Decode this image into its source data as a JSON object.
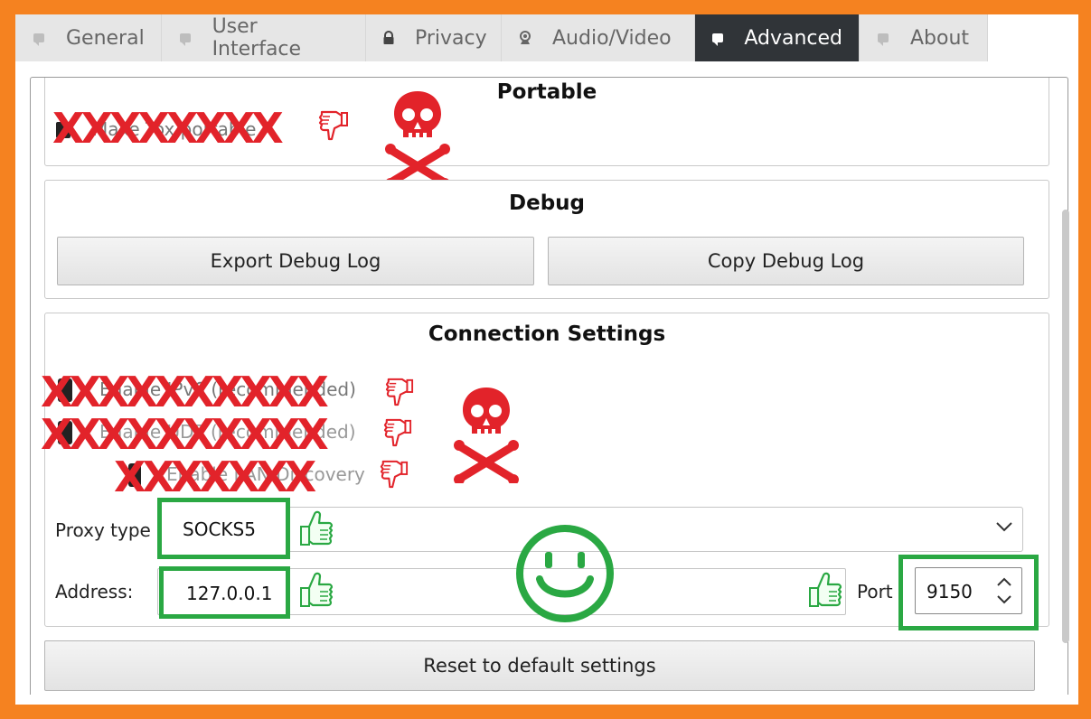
{
  "tabs": [
    {
      "label": "General",
      "icon": "tab-window-icon",
      "active": false
    },
    {
      "label": "User Interface",
      "icon": "tab-window-icon",
      "active": false
    },
    {
      "label": "Privacy",
      "icon": "lock-icon",
      "active": false
    },
    {
      "label": "Audio/Video",
      "icon": "webcam-icon",
      "active": false
    },
    {
      "label": "Advanced",
      "icon": "tab-window-icon",
      "active": true
    },
    {
      "label": "About",
      "icon": "tab-window-icon",
      "active": false
    }
  ],
  "portable": {
    "title": "Portable",
    "checkbox_label": "Make Tox portable",
    "struck_mark": "XXXXXXXX"
  },
  "debug": {
    "title": "Debug",
    "export_label": "Export Debug Log",
    "copy_label": "Copy Debug Log"
  },
  "connection": {
    "title": "Connection Settings",
    "options": [
      {
        "label": "Enable IPv6 (recommended)",
        "struck_mark": "XXXXXXXXXX"
      },
      {
        "label": "Enable UDP (recommended)",
        "struck_mark": "XXXXXXXXXX"
      },
      {
        "label": "Enable LAN Discovery",
        "struck_mark": "XXXXXXX"
      }
    ],
    "proxy_type_label": "Proxy type",
    "proxy_type_value": "SOCKS5",
    "address_label": "Address:",
    "address_value": "127.0.0.1",
    "port_label": "Port",
    "port_value": "9150"
  },
  "reset_label": "Reset to default settings",
  "colors": {
    "frame": "#f58220",
    "highlight_green": "#2aa843",
    "warning_red": "#e2232a",
    "active_tab": "#303438"
  },
  "annotations": [
    "thumbs-down-icon",
    "thumbs-up-icon",
    "skull-crossbones-icon",
    "smiley-face-icon"
  ]
}
